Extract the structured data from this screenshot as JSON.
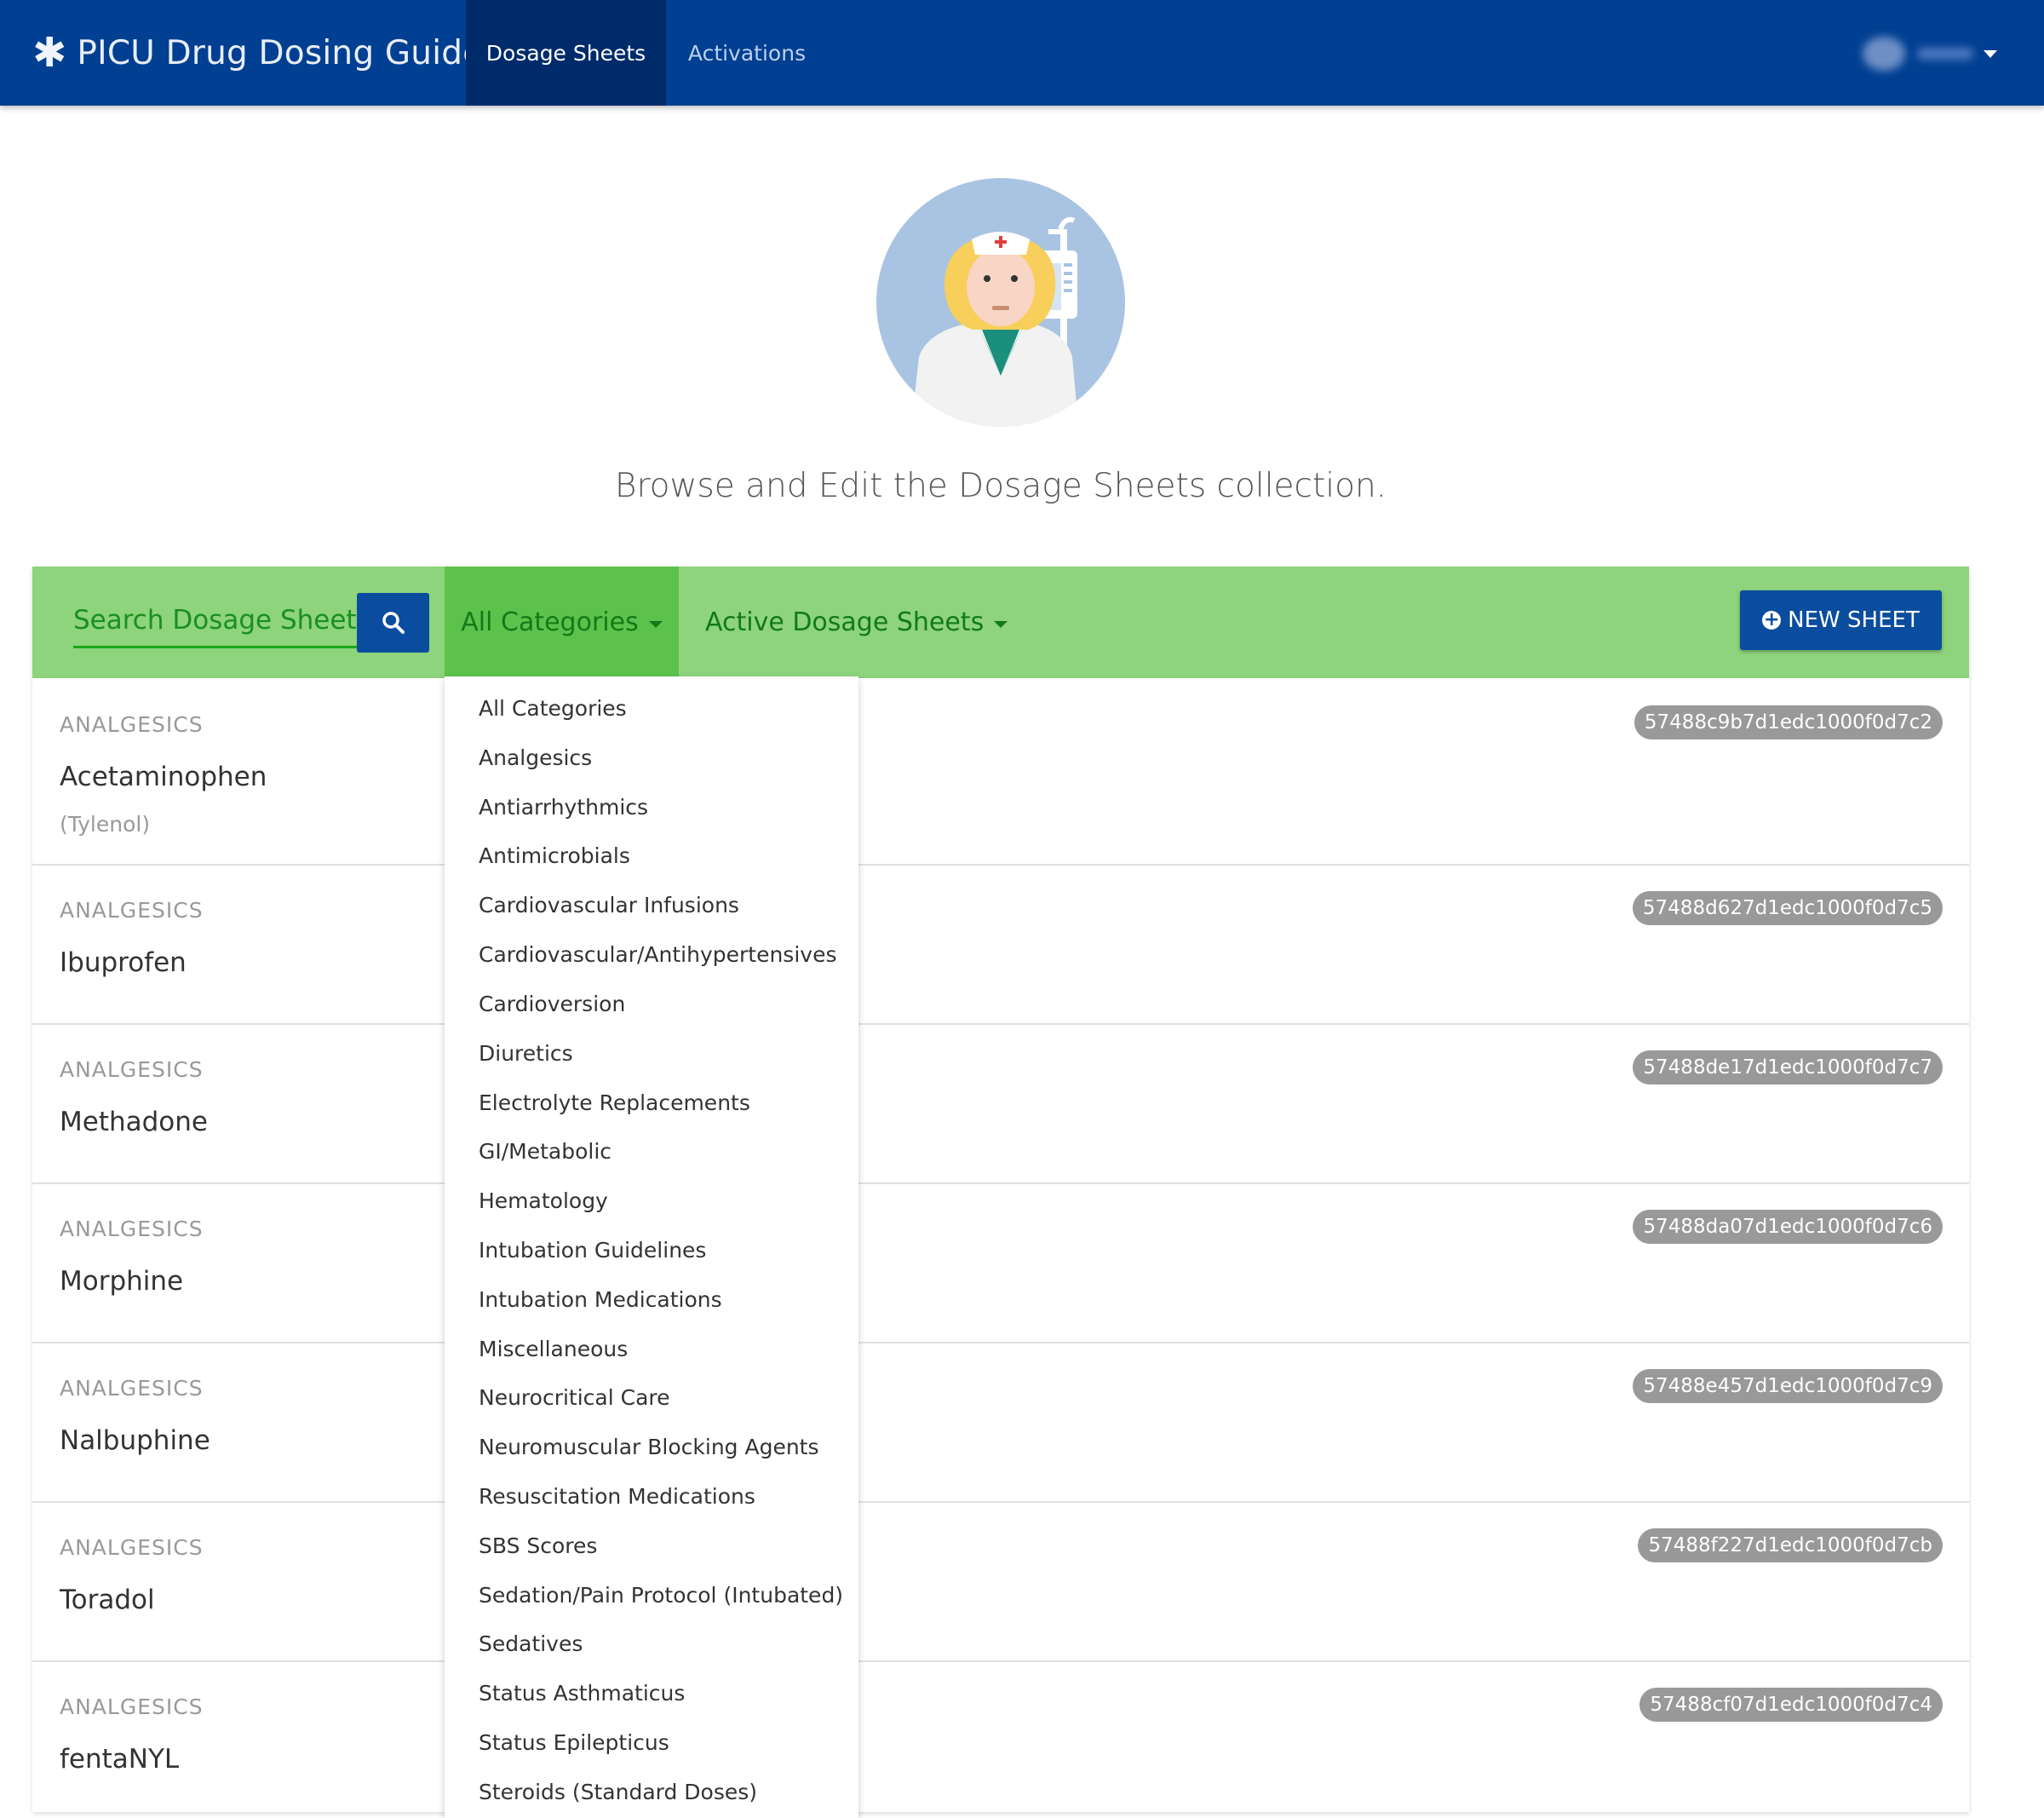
{
  "navbar": {
    "brand": "PICU Drug Dosing Guide",
    "tabs": [
      {
        "label": "Dosage Sheets"
      },
      {
        "label": "Activations"
      }
    ]
  },
  "hero": {
    "tagline": "Browse and Edit the Dosage Sheets collection."
  },
  "toolbar": {
    "search_placeholder": "Search Dosage Sheets",
    "category_filter": "All Categories",
    "status_filter": "Active Dosage Sheets",
    "new_sheet": "NEW SHEET"
  },
  "categories_dropdown": [
    "All Categories",
    "Analgesics",
    "Antiarrhythmics",
    "Antimicrobials",
    "Cardiovascular Infusions",
    "Cardiovascular/Antihypertensives",
    "Cardioversion",
    "Diuretics",
    "Electrolyte Replacements",
    "GI/Metabolic",
    "Hematology",
    "Intubation Guidelines",
    "Intubation Medications",
    "Miscellaneous",
    "Neurocritical Care",
    "Neuromuscular Blocking Agents",
    "Resuscitation Medications",
    "SBS Scores",
    "Sedation/Pain Protocol (Intubated)",
    "Sedatives",
    "Status Asthmaticus",
    "Status Epilepticus",
    "Steroids (Standard Doses)"
  ],
  "sheets": [
    {
      "category": "ANALGESICS",
      "name": "Acetaminophen",
      "alias": "(Tylenol)",
      "id": "57488c9b7d1edc1000f0d7c2"
    },
    {
      "category": "ANALGESICS",
      "name": "Ibuprofen",
      "alias": "",
      "id": "57488d627d1edc1000f0d7c5"
    },
    {
      "category": "ANALGESICS",
      "name": "Methadone",
      "alias": "",
      "id": "57488de17d1edc1000f0d7c7"
    },
    {
      "category": "ANALGESICS",
      "name": "Morphine",
      "alias": "",
      "id": "57488da07d1edc1000f0d7c6"
    },
    {
      "category": "ANALGESICS",
      "name": "Nalbuphine",
      "alias": "",
      "id": "57488e457d1edc1000f0d7c9"
    },
    {
      "category": "ANALGESICS",
      "name": "Toradol",
      "alias": "",
      "id": "57488f227d1edc1000f0d7cb"
    },
    {
      "category": "ANALGESICS",
      "name": "fentaNYL",
      "alias": "",
      "id": "57488cf07d1edc1000f0d7c4"
    }
  ]
}
